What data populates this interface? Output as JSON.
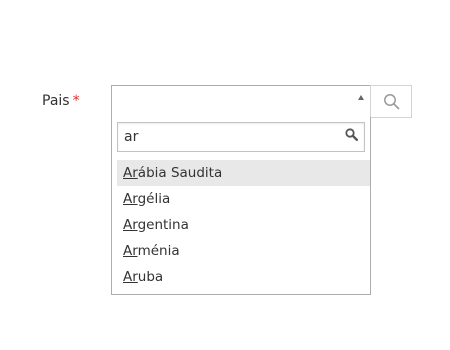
{
  "field": {
    "label": "Pais",
    "required_mark": "*",
    "selected_value": ""
  },
  "filter": {
    "value": "ar"
  },
  "options": [
    {
      "match": "Ar",
      "rest": "ábia Saudita",
      "highlighted": true
    },
    {
      "match": "Ar",
      "rest": "gélia",
      "highlighted": false
    },
    {
      "match": "Ar",
      "rest": "gentina",
      "highlighted": false
    },
    {
      "match": "Ar",
      "rest": "ménia",
      "highlighted": false
    },
    {
      "match": "Ar",
      "rest": "uba",
      "highlighted": false
    }
  ],
  "icons": {
    "caret": "caret-up-icon",
    "search_button": "magnifier-icon",
    "filter": "search-icon"
  },
  "colors": {
    "required": "#e02b27",
    "highlight": "#e8e8e8",
    "border": "#adadad"
  }
}
